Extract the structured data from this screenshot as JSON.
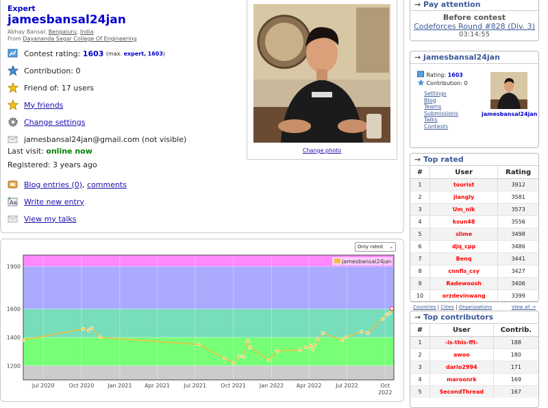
{
  "profile": {
    "rank": "Expert",
    "handle": "jamesbansal24jan",
    "name": "Abhay Bansal",
    "city": "Bengaluru",
    "country": "India",
    "from_prefix": "From",
    "organization": "Dayananda Sagar College Of Engineering",
    "rating_label": "Contest rating:",
    "rating": "1603",
    "max_prefix": "(max.",
    "max_rank": "expert,",
    "max_rating": "1603",
    "max_suffix": ")",
    "contribution_label": "Contribution:",
    "contribution": "0",
    "friend_label": "Friend of:",
    "friend_count": "17 users",
    "my_friends": "My friends",
    "change_settings": "Change settings",
    "email": "jamesbansal24jan@gmail.com",
    "email_note": "(not visible)",
    "last_visit_label": "Last visit:",
    "last_visit": "online now",
    "registered_label": "Registered:",
    "registered": "3 years ago",
    "blog_entries": "Blog entries (0)",
    "comments": "comments",
    "write_new": "Write new entry",
    "view_talks": "View my talks",
    "change_photo": "Change photo"
  },
  "chart": {
    "filter": "Only rated",
    "legend": "jamesbansal24jan"
  },
  "chart_data": {
    "type": "line",
    "title": "",
    "series": [
      {
        "name": "jamesbansal24jan",
        "points": [
          [
            "2020-05-14",
            1380
          ],
          [
            "2020-10-05",
            1460
          ],
          [
            "2020-10-18",
            1448
          ],
          [
            "2020-10-25",
            1465
          ],
          [
            "2020-11-15",
            1400
          ],
          [
            "2021-07-10",
            1350
          ],
          [
            "2021-09-10",
            1250
          ],
          [
            "2021-10-02",
            1220
          ],
          [
            "2021-10-15",
            1265
          ],
          [
            "2021-10-25",
            1265
          ],
          [
            "2021-11-05",
            1375
          ],
          [
            "2021-11-10",
            1330
          ],
          [
            "2021-12-25",
            1240
          ],
          [
            "2022-01-15",
            1305
          ],
          [
            "2022-03-10",
            1310
          ],
          [
            "2022-03-25",
            1330
          ],
          [
            "2022-04-05",
            1340
          ],
          [
            "2022-04-10",
            1315
          ],
          [
            "2022-04-15",
            1345
          ],
          [
            "2022-04-22",
            1390
          ],
          [
            "2022-05-05",
            1430
          ],
          [
            "2022-06-20",
            1380
          ],
          [
            "2022-06-28",
            1400
          ],
          [
            "2022-08-05",
            1440
          ],
          [
            "2022-08-20",
            1430
          ],
          [
            "2022-09-25",
            1530
          ],
          [
            "2022-10-05",
            1560
          ],
          [
            "2022-10-12",
            1570
          ],
          [
            "2022-10-17",
            1603
          ]
        ]
      }
    ],
    "xticks": [
      {
        "date": "2020-07-01",
        "label": "Jul 2020"
      },
      {
        "date": "2020-10-01",
        "label": "Oct 2020"
      },
      {
        "date": "2021-01-01",
        "label": "Jan 2021"
      },
      {
        "date": "2021-04-01",
        "label": "Apr 2021"
      },
      {
        "date": "2021-07-01",
        "label": "Jul 2021"
      },
      {
        "date": "2021-10-01",
        "label": "Oct 2021"
      },
      {
        "date": "2022-01-01",
        "label": "Jan 2022"
      },
      {
        "date": "2022-04-01",
        "label": "Apr 2022"
      },
      {
        "date": "2022-07-01",
        "label": "Jul 2022"
      },
      {
        "date": "2022-10-01",
        "label": "Oct"
      }
    ],
    "xtick_sublabel": "2022",
    "yticks": [
      1200,
      1400,
      1600,
      1900
    ],
    "ylim": [
      1100,
      1980
    ],
    "xlim": [
      "2020-05-14",
      "2022-10-22"
    ],
    "bands": [
      {
        "from": 1100,
        "to": 1200,
        "color": "#cccccc"
      },
      {
        "from": 1200,
        "to": 1400,
        "color": "#77ff77"
      },
      {
        "from": 1400,
        "to": 1600,
        "color": "#77ddbb"
      },
      {
        "from": 1600,
        "to": 1900,
        "color": "#aaaaff"
      },
      {
        "from": 1900,
        "to": 1980,
        "color": "#ff88ff"
      }
    ],
    "line_color": "#edc240"
  },
  "sidebar": {
    "attention_title": "Pay attention",
    "before_contest": "Before contest",
    "contest_name": "Codeforces Round #828 (Div. 3)",
    "countdown": "03:14:55",
    "user_box_title": "jamesbansal24jan",
    "rating_label": "Rating:",
    "rating": "1603",
    "contribution_label": "Contribution:",
    "contribution": "0",
    "handle": "jamesbansal24jan",
    "links": [
      "Settings",
      "Blog",
      "Teams",
      "Submissions",
      "Talks",
      "Contests"
    ],
    "top_rated_title": "Top rated",
    "top_rated_headers": [
      "#",
      "User",
      "Rating"
    ],
    "top_rated": [
      {
        "n": "1",
        "user": "tourist",
        "val": "3912"
      },
      {
        "n": "2",
        "user": "jiangly",
        "val": "3581"
      },
      {
        "n": "3",
        "user": "Um_nik",
        "val": "3573"
      },
      {
        "n": "4",
        "user": "ksun48",
        "val": "3556"
      },
      {
        "n": "5",
        "user": "slime",
        "val": "3498"
      },
      {
        "n": "6",
        "user": "djq_cpp",
        "val": "3486"
      },
      {
        "n": "7",
        "user": "Benq",
        "val": "3441"
      },
      {
        "n": "8",
        "user": "cnnfls_csy",
        "val": "3427"
      },
      {
        "n": "9",
        "user": "Radewoosh",
        "val": "3406"
      },
      {
        "n": "10",
        "user": "orzdevinwang",
        "val": "3399"
      }
    ],
    "foot_countries": "Countries",
    "foot_cities": "Cities",
    "foot_orgs": "Organizations",
    "foot_view_all": "View all →",
    "top_contrib_title": "Top contributors",
    "top_contrib_headers": [
      "#",
      "User",
      "Contrib."
    ],
    "top_contrib": [
      {
        "n": "1",
        "user": "-is-this-fft-",
        "val": "188"
      },
      {
        "n": "2",
        "user": "awoo",
        "val": "180"
      },
      {
        "n": "3",
        "user": "dario2994",
        "val": "171"
      },
      {
        "n": "4",
        "user": "maroonrk",
        "val": "169"
      },
      {
        "n": "5",
        "user": "SecondThread",
        "val": "167"
      }
    ]
  },
  "colors": {
    "accent": "#3b5998",
    "handle": "#0000cc",
    "red_user": "#ff0000",
    "online": "#008000"
  }
}
